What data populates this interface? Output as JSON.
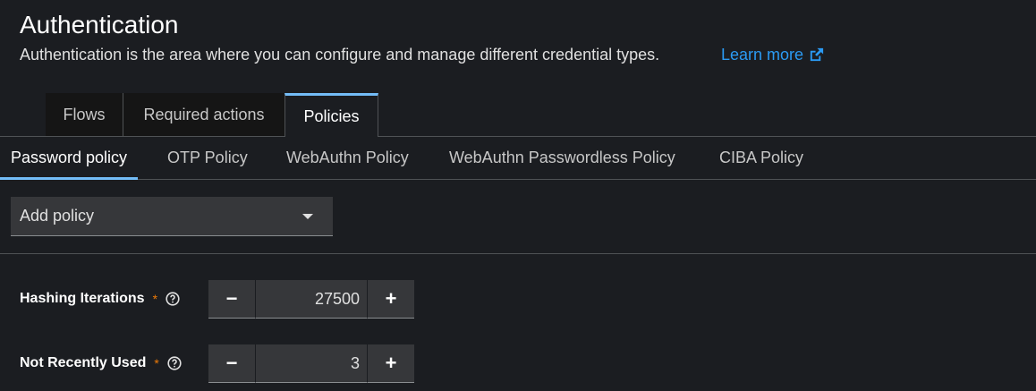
{
  "header": {
    "title": "Authentication",
    "description": "Authentication is the area where you can configure and manage different credential types.",
    "learn_more": "Learn more"
  },
  "tabs": [
    {
      "label": "Flows",
      "active": false
    },
    {
      "label": "Required actions",
      "active": false
    },
    {
      "label": "Policies",
      "active": true
    }
  ],
  "subtabs": [
    {
      "label": "Password policy",
      "active": true
    },
    {
      "label": "OTP Policy",
      "active": false
    },
    {
      "label": "WebAuthn Policy",
      "active": false
    },
    {
      "label": "WebAuthn Passwordless Policy",
      "active": false
    },
    {
      "label": "CIBA Policy",
      "active": false
    }
  ],
  "add_policy": {
    "label": "Add policy"
  },
  "fields": [
    {
      "label": "Hashing Iterations",
      "required": "*",
      "value": "27500",
      "minus": "−",
      "plus": "+"
    },
    {
      "label": "Not Recently Used",
      "required": "*",
      "value": "3",
      "minus": "−",
      "plus": "+"
    }
  ],
  "icons": {
    "external_link": "external-link-icon",
    "help": "help-icon",
    "caret": "caret-down-icon"
  },
  "colors": {
    "background": "#1b1d21",
    "accent": "#73bcf7",
    "link": "#2b9af3",
    "required": "#ec7a08"
  }
}
